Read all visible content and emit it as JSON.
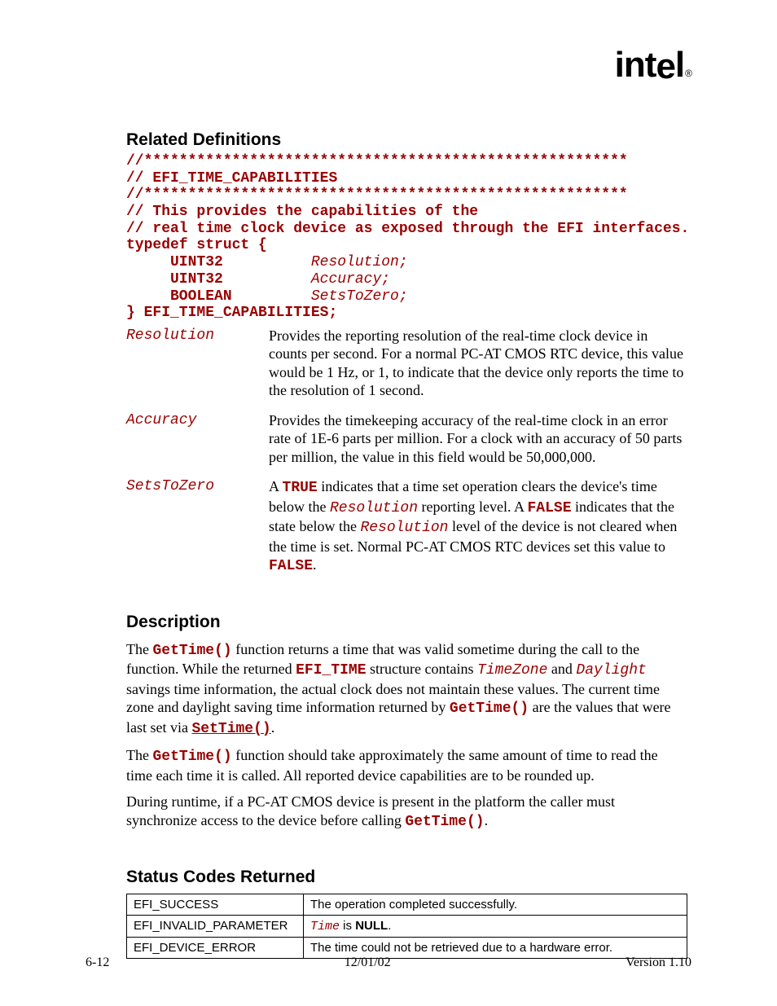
{
  "logo": "intel",
  "headings": {
    "related": "Related Definitions",
    "description": "Description",
    "status": "Status Codes Returned"
  },
  "code_lines": [
    {
      "plain": "//*******************************************************"
    },
    {
      "plain": "// EFI_TIME_CAPABILITIES"
    },
    {
      "plain": "//*******************************************************"
    },
    {
      "plain": "// This provides the capabilities of the"
    },
    {
      "plain": "// real time clock device as exposed through the EFI interfaces."
    },
    {
      "plain": "typedef struct {"
    },
    {
      "plain": "     UINT32          ",
      "ital": "Resolution;"
    },
    {
      "plain": "     UINT32          ",
      "ital": "Accuracy;"
    },
    {
      "plain": "     BOOLEAN         ",
      "ital": "SetsToZero;"
    },
    {
      "plain": "} EFI_TIME_CAPABILITIES;"
    }
  ],
  "params": {
    "resolution": {
      "name": "Resolution",
      "desc": "Provides the reporting resolution of the real-time clock device in counts per second.  For a normal PC-AT CMOS RTC device, this value would be 1 Hz, or 1, to indicate that the device only reports the time to the resolution of 1 second."
    },
    "accuracy": {
      "name": "Accuracy",
      "desc": "Provides the timekeeping accuracy of the real-time clock in an error rate of 1E-6 parts per million.  For a clock with an accuracy of 50 parts per million, the value in this field would be 50,000,000."
    },
    "setstozero": {
      "name": "SetsToZero",
      "pre": "A ",
      "true": "TRUE",
      "mid1": " indicates that a time set operation clears the device's time below the ",
      "res1": "Resolution",
      "mid2": " reporting level.  A ",
      "false": "FALSE",
      "mid3": " indicates that the state below the ",
      "res2": "Resolution",
      "mid4": " level of the device is not cleared when the time is set.  Normal PC-AT CMOS RTC devices set this value to ",
      "false2": "FALSE",
      "dot": "."
    }
  },
  "description": {
    "p1": {
      "a": "The ",
      "gettime": "GetTime()",
      "b": " function returns a time that was valid sometime during the call to the function.  While the returned ",
      "efitime": "EFI_TIME",
      "c": " structure contains ",
      "tz": "TimeZone",
      "d": " and ",
      "daylight": "Daylight",
      "e": " savings time information, the actual clock does not maintain these values.  The current time zone and daylight saving time information returned by ",
      "gettime2": "GetTime()",
      "f": " are the values that were last set via ",
      "settime": "SetTime()",
      "g": "."
    },
    "p2": {
      "a": "The ",
      "gettime": "GetTime()",
      "b": " function should take approximately the same amount of time to read the time each time it is called.  All reported device capabilities are to be rounded up."
    },
    "p3": {
      "a": "During runtime, if a PC-AT CMOS device is present in the platform the caller must synchronize access to the device before calling ",
      "gettime": "GetTime()",
      "b": "."
    }
  },
  "status_table": [
    {
      "code": "EFI_SUCCESS",
      "desc_plain": "The operation completed successfully."
    },
    {
      "code": "EFI_INVALID_PARAMETER",
      "desc_mono": "Time",
      "desc_mid": " is ",
      "desc_bold": "NULL",
      "desc_end": "."
    },
    {
      "code": "EFI_DEVICE_ERROR",
      "desc_plain": "The time could not be retrieved due to a hardware error."
    }
  ],
  "footer": {
    "left": "6-12",
    "center": "12/01/02",
    "right": "Version 1.10"
  }
}
